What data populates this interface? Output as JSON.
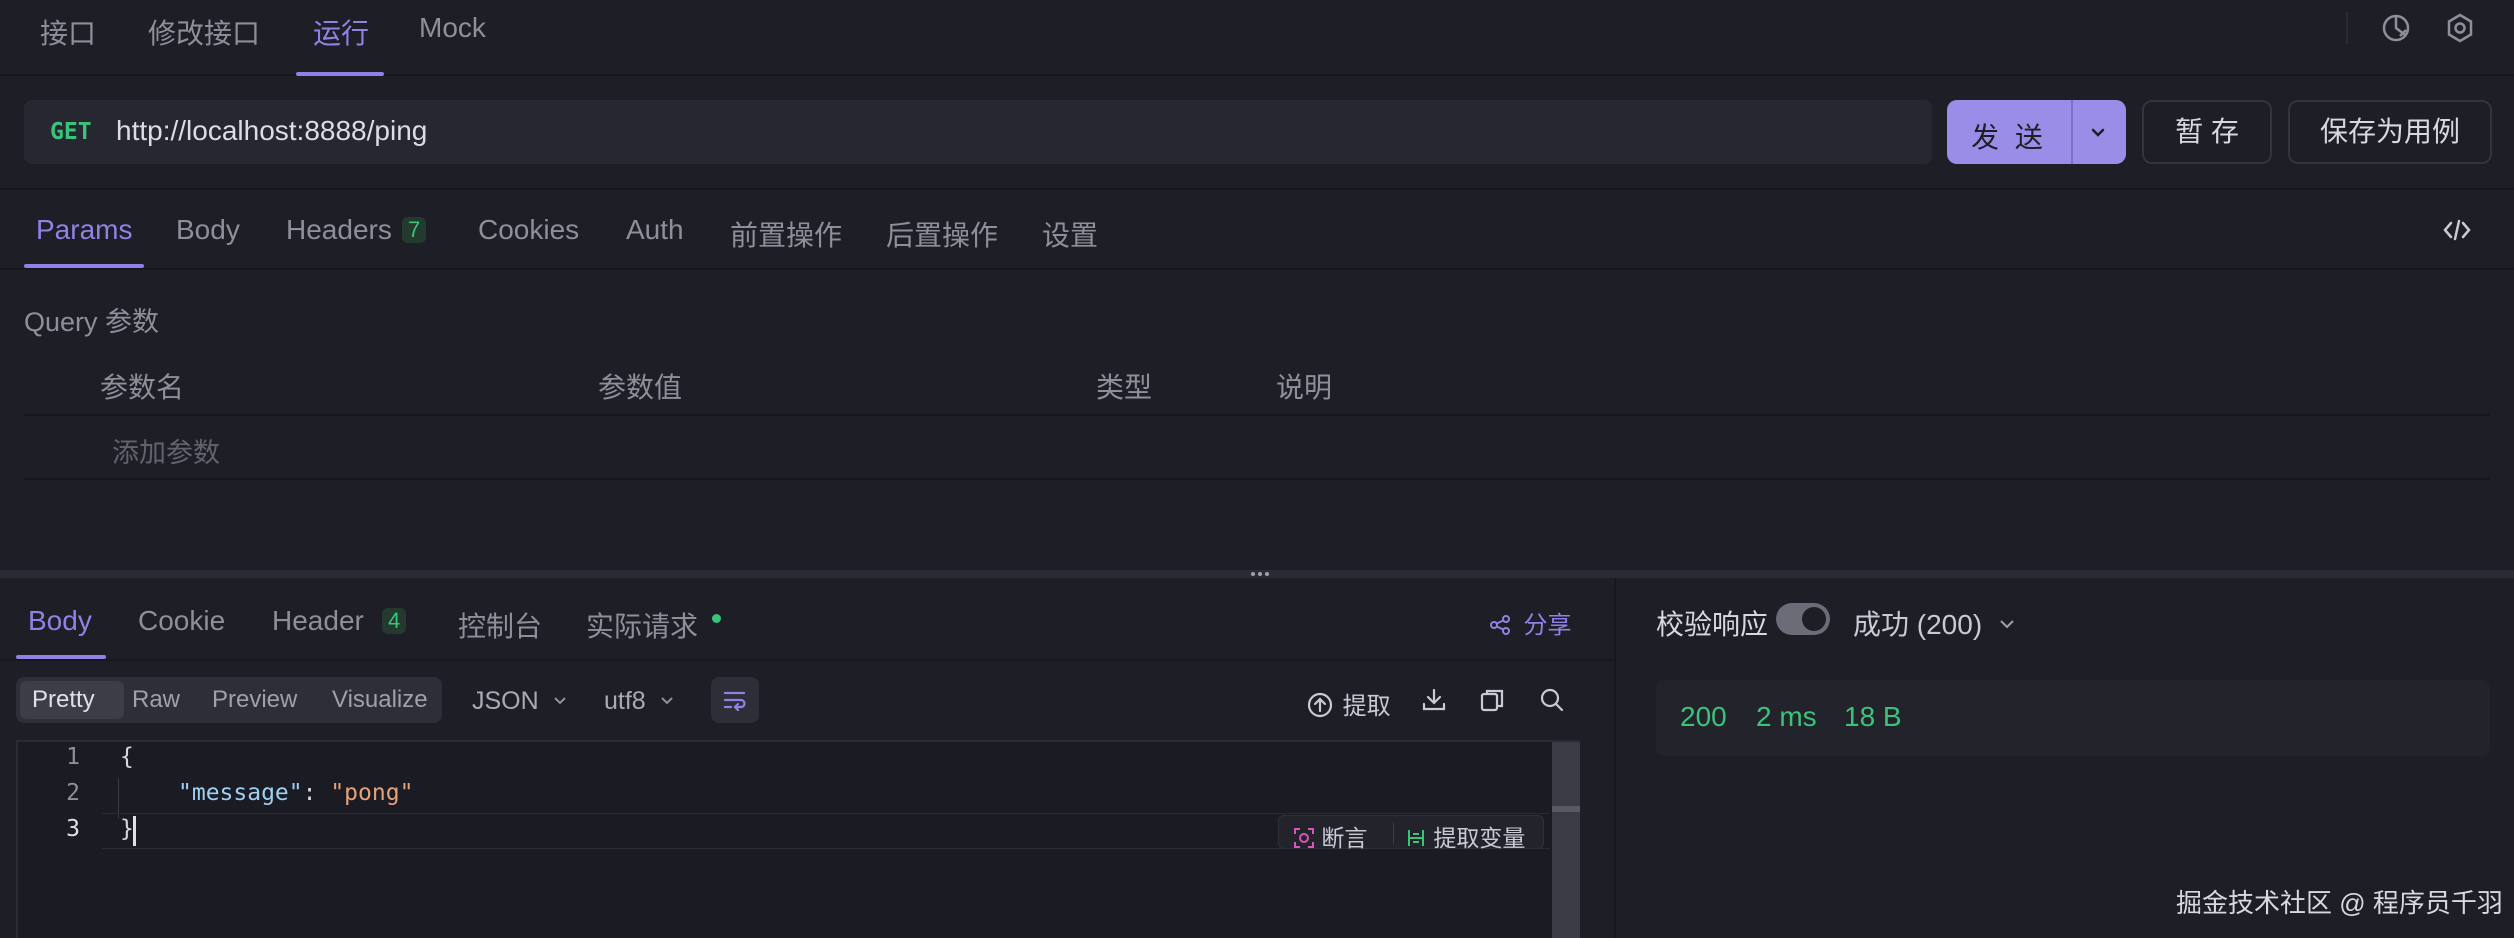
{
  "top_tabs": [
    {
      "label": "接口"
    },
    {
      "label": "修改接口"
    },
    {
      "label": "运行"
    },
    {
      "label": "Mock"
    }
  ],
  "request": {
    "method": "GET",
    "url": "http://localhost:8888/ping",
    "send_label": "发 送",
    "save_label": "暂 存",
    "save_case_label": "保存为用例"
  },
  "param_tabs": [
    {
      "label": "Params"
    },
    {
      "label": "Body"
    },
    {
      "label": "Headers",
      "badge": "7"
    },
    {
      "label": "Cookies"
    },
    {
      "label": "Auth"
    },
    {
      "label": "前置操作"
    },
    {
      "label": "后置操作"
    },
    {
      "label": "设置"
    }
  ],
  "query": {
    "section_label": "Query 参数",
    "columns": [
      "参数名",
      "参数值",
      "类型",
      "说明"
    ],
    "add_placeholder": "添加参数"
  },
  "response_tabs": [
    {
      "label": "Body"
    },
    {
      "label": "Cookie"
    },
    {
      "label": "Header",
      "badge": "4"
    },
    {
      "label": "控制台"
    },
    {
      "label": "实际请求"
    }
  ],
  "share_label": "分享",
  "view_modes": [
    "Pretty",
    "Raw",
    "Preview",
    "Visualize"
  ],
  "format": {
    "selected": "JSON"
  },
  "encoding": {
    "selected": "utf8"
  },
  "extract_label": "提取",
  "code_lines": [
    {
      "num": "1"
    },
    {
      "num": "2",
      "key": "\"message\"",
      "sep": ": ",
      "value": "\"pong\""
    },
    {
      "num": "3"
    }
  ],
  "code_open": "{",
  "code_close": "}",
  "inline_actions": {
    "assert": "断言",
    "extract_var": "提取变量"
  },
  "validate": {
    "label": "校验响应",
    "enabled": true,
    "status": "成功 (200)"
  },
  "metrics": {
    "status": "200",
    "time": "2 ms",
    "size": "18 B"
  },
  "watermark": "掘金技术社区 @ 程序员千羽",
  "colors": {
    "background": "#1e1e27",
    "accent": "#8f82e6",
    "success": "#39c47a",
    "send_button": "#9a8de8"
  }
}
